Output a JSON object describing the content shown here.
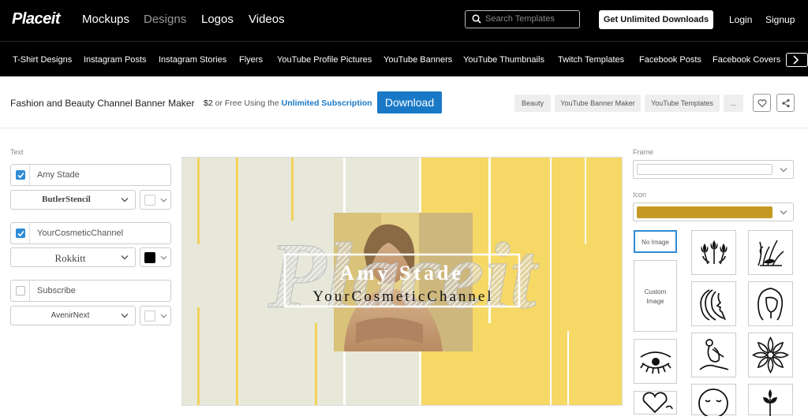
{
  "nav": {
    "logo": "Placeit",
    "links": [
      "Mockups",
      "Designs",
      "Logos",
      "Videos"
    ],
    "search_placeholder": "Search Templates",
    "cta": "Get Unlimited Downloads",
    "login": "Login",
    "signup": "Signup"
  },
  "categories": [
    "T-Shirt Designs",
    "Instagram Posts",
    "Instagram Stories",
    "Flyers",
    "YouTube Profile Pictures",
    "YouTube Banners",
    "YouTube Thumbnails",
    "Twitch Templates",
    "Facebook Posts",
    "Facebook Covers"
  ],
  "header": {
    "title": "Fashion and Beauty Channel Banner Maker",
    "price": "$2",
    "price_or": "or Free Using the",
    "subscription_link": "Unlimited Subscription",
    "download": "Download",
    "tags": [
      "Beauty",
      "YouTube Banner Maker",
      "YouTube Templates",
      "..."
    ]
  },
  "left_panel": {
    "section_label": "Text",
    "rows": [
      {
        "checked": true,
        "value": "Amy Stade",
        "font": "ButlerStencil",
        "color": "#ffffff"
      },
      {
        "checked": true,
        "value": "YourCosmeticChannel",
        "font": "Rokkitt",
        "color": "#000000"
      },
      {
        "checked": false,
        "value": "Subscribe",
        "font": "AvenirNext",
        "color": "#ffffff"
      }
    ]
  },
  "canvas": {
    "name": "Amy Stade",
    "channel": "YourCosmeticChannel",
    "watermark": "Placeit",
    "colors": {
      "left_bg": "#e8e8da",
      "right_bg": "#f6d866",
      "stripe": "#f3d25a"
    }
  },
  "right_panel": {
    "frame_label": "Frame",
    "icon_label": "Icon",
    "icon_color": "#c49a24",
    "tiles": [
      {
        "label": "No Image",
        "selected": true
      },
      {
        "icon": "tulips-icon"
      },
      {
        "icon": "grass-icon"
      },
      {
        "label": "Custom Image"
      },
      {
        "icon": "woman-hair-icon"
      },
      {
        "icon": "woman-profile-icon"
      },
      {
        "icon": "eye-lashes-icon"
      },
      {
        "icon": "yoga-pose-icon"
      },
      {
        "icon": "lotus-flower-icon"
      },
      {
        "icon": "heart-icon"
      },
      {
        "icon": "face-icon"
      },
      {
        "icon": "plant-icon"
      }
    ]
  }
}
